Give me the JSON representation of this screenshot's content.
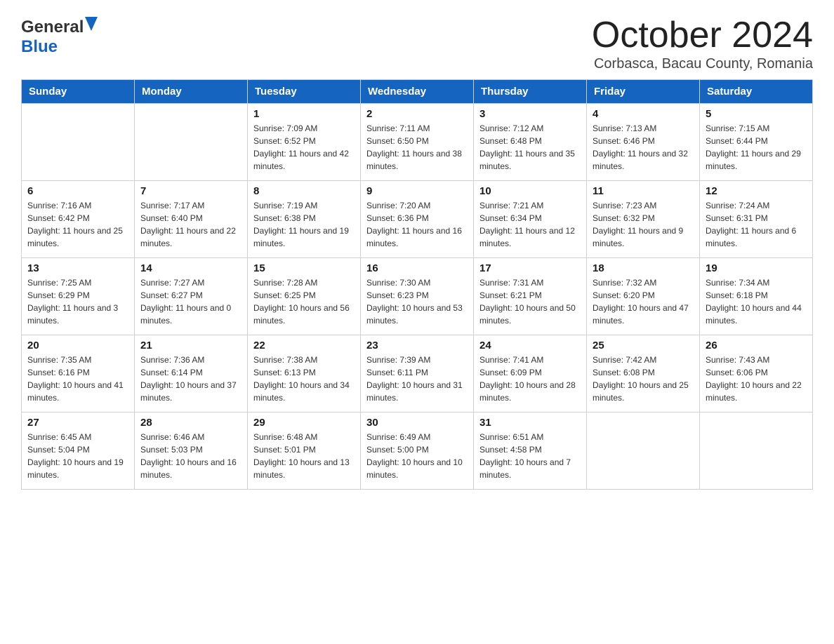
{
  "header": {
    "month_title": "October 2024",
    "location": "Corbasca, Bacau County, Romania",
    "logo_general": "General",
    "logo_blue": "Blue"
  },
  "weekdays": [
    "Sunday",
    "Monday",
    "Tuesday",
    "Wednesday",
    "Thursday",
    "Friday",
    "Saturday"
  ],
  "weeks": [
    [
      {
        "day": "",
        "sunrise": "",
        "sunset": "",
        "daylight": ""
      },
      {
        "day": "",
        "sunrise": "",
        "sunset": "",
        "daylight": ""
      },
      {
        "day": "1",
        "sunrise": "Sunrise: 7:09 AM",
        "sunset": "Sunset: 6:52 PM",
        "daylight": "Daylight: 11 hours and 42 minutes."
      },
      {
        "day": "2",
        "sunrise": "Sunrise: 7:11 AM",
        "sunset": "Sunset: 6:50 PM",
        "daylight": "Daylight: 11 hours and 38 minutes."
      },
      {
        "day": "3",
        "sunrise": "Sunrise: 7:12 AM",
        "sunset": "Sunset: 6:48 PM",
        "daylight": "Daylight: 11 hours and 35 minutes."
      },
      {
        "day": "4",
        "sunrise": "Sunrise: 7:13 AM",
        "sunset": "Sunset: 6:46 PM",
        "daylight": "Daylight: 11 hours and 32 minutes."
      },
      {
        "day": "5",
        "sunrise": "Sunrise: 7:15 AM",
        "sunset": "Sunset: 6:44 PM",
        "daylight": "Daylight: 11 hours and 29 minutes."
      }
    ],
    [
      {
        "day": "6",
        "sunrise": "Sunrise: 7:16 AM",
        "sunset": "Sunset: 6:42 PM",
        "daylight": "Daylight: 11 hours and 25 minutes."
      },
      {
        "day": "7",
        "sunrise": "Sunrise: 7:17 AM",
        "sunset": "Sunset: 6:40 PM",
        "daylight": "Daylight: 11 hours and 22 minutes."
      },
      {
        "day": "8",
        "sunrise": "Sunrise: 7:19 AM",
        "sunset": "Sunset: 6:38 PM",
        "daylight": "Daylight: 11 hours and 19 minutes."
      },
      {
        "day": "9",
        "sunrise": "Sunrise: 7:20 AM",
        "sunset": "Sunset: 6:36 PM",
        "daylight": "Daylight: 11 hours and 16 minutes."
      },
      {
        "day": "10",
        "sunrise": "Sunrise: 7:21 AM",
        "sunset": "Sunset: 6:34 PM",
        "daylight": "Daylight: 11 hours and 12 minutes."
      },
      {
        "day": "11",
        "sunrise": "Sunrise: 7:23 AM",
        "sunset": "Sunset: 6:32 PM",
        "daylight": "Daylight: 11 hours and 9 minutes."
      },
      {
        "day": "12",
        "sunrise": "Sunrise: 7:24 AM",
        "sunset": "Sunset: 6:31 PM",
        "daylight": "Daylight: 11 hours and 6 minutes."
      }
    ],
    [
      {
        "day": "13",
        "sunrise": "Sunrise: 7:25 AM",
        "sunset": "Sunset: 6:29 PM",
        "daylight": "Daylight: 11 hours and 3 minutes."
      },
      {
        "day": "14",
        "sunrise": "Sunrise: 7:27 AM",
        "sunset": "Sunset: 6:27 PM",
        "daylight": "Daylight: 11 hours and 0 minutes."
      },
      {
        "day": "15",
        "sunrise": "Sunrise: 7:28 AM",
        "sunset": "Sunset: 6:25 PM",
        "daylight": "Daylight: 10 hours and 56 minutes."
      },
      {
        "day": "16",
        "sunrise": "Sunrise: 7:30 AM",
        "sunset": "Sunset: 6:23 PM",
        "daylight": "Daylight: 10 hours and 53 minutes."
      },
      {
        "day": "17",
        "sunrise": "Sunrise: 7:31 AM",
        "sunset": "Sunset: 6:21 PM",
        "daylight": "Daylight: 10 hours and 50 minutes."
      },
      {
        "day": "18",
        "sunrise": "Sunrise: 7:32 AM",
        "sunset": "Sunset: 6:20 PM",
        "daylight": "Daylight: 10 hours and 47 minutes."
      },
      {
        "day": "19",
        "sunrise": "Sunrise: 7:34 AM",
        "sunset": "Sunset: 6:18 PM",
        "daylight": "Daylight: 10 hours and 44 minutes."
      }
    ],
    [
      {
        "day": "20",
        "sunrise": "Sunrise: 7:35 AM",
        "sunset": "Sunset: 6:16 PM",
        "daylight": "Daylight: 10 hours and 41 minutes."
      },
      {
        "day": "21",
        "sunrise": "Sunrise: 7:36 AM",
        "sunset": "Sunset: 6:14 PM",
        "daylight": "Daylight: 10 hours and 37 minutes."
      },
      {
        "day": "22",
        "sunrise": "Sunrise: 7:38 AM",
        "sunset": "Sunset: 6:13 PM",
        "daylight": "Daylight: 10 hours and 34 minutes."
      },
      {
        "day": "23",
        "sunrise": "Sunrise: 7:39 AM",
        "sunset": "Sunset: 6:11 PM",
        "daylight": "Daylight: 10 hours and 31 minutes."
      },
      {
        "day": "24",
        "sunrise": "Sunrise: 7:41 AM",
        "sunset": "Sunset: 6:09 PM",
        "daylight": "Daylight: 10 hours and 28 minutes."
      },
      {
        "day": "25",
        "sunrise": "Sunrise: 7:42 AM",
        "sunset": "Sunset: 6:08 PM",
        "daylight": "Daylight: 10 hours and 25 minutes."
      },
      {
        "day": "26",
        "sunrise": "Sunrise: 7:43 AM",
        "sunset": "Sunset: 6:06 PM",
        "daylight": "Daylight: 10 hours and 22 minutes."
      }
    ],
    [
      {
        "day": "27",
        "sunrise": "Sunrise: 6:45 AM",
        "sunset": "Sunset: 5:04 PM",
        "daylight": "Daylight: 10 hours and 19 minutes."
      },
      {
        "day": "28",
        "sunrise": "Sunrise: 6:46 AM",
        "sunset": "Sunset: 5:03 PM",
        "daylight": "Daylight: 10 hours and 16 minutes."
      },
      {
        "day": "29",
        "sunrise": "Sunrise: 6:48 AM",
        "sunset": "Sunset: 5:01 PM",
        "daylight": "Daylight: 10 hours and 13 minutes."
      },
      {
        "day": "30",
        "sunrise": "Sunrise: 6:49 AM",
        "sunset": "Sunset: 5:00 PM",
        "daylight": "Daylight: 10 hours and 10 minutes."
      },
      {
        "day": "31",
        "sunrise": "Sunrise: 6:51 AM",
        "sunset": "Sunset: 4:58 PM",
        "daylight": "Daylight: 10 hours and 7 minutes."
      },
      {
        "day": "",
        "sunrise": "",
        "sunset": "",
        "daylight": ""
      },
      {
        "day": "",
        "sunrise": "",
        "sunset": "",
        "daylight": ""
      }
    ]
  ]
}
